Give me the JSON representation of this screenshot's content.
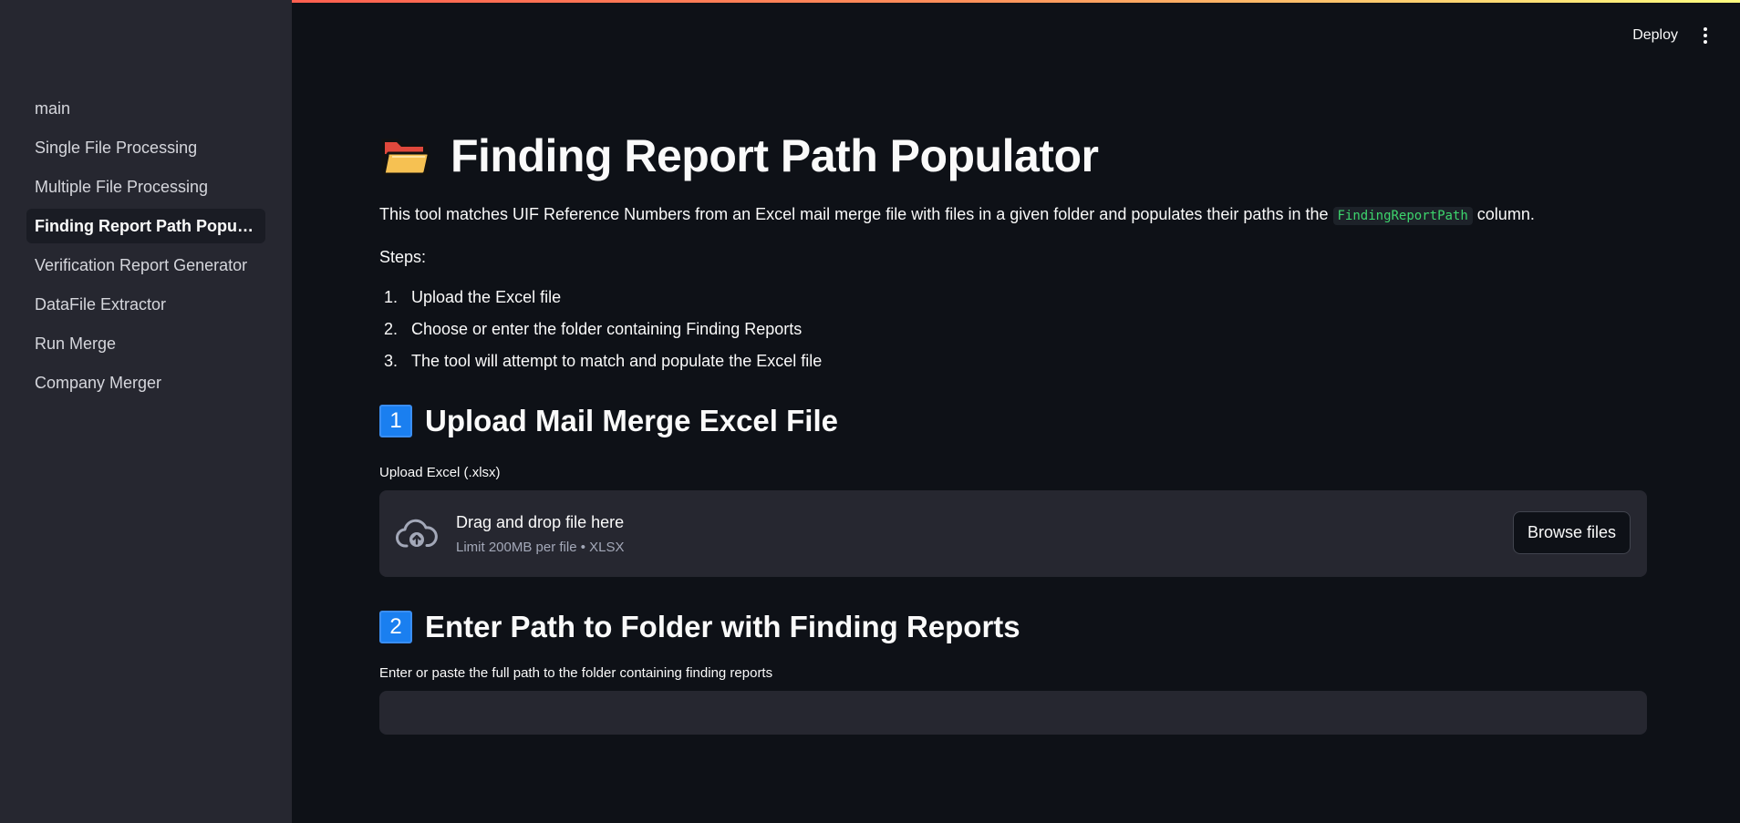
{
  "sidebar": {
    "items": [
      {
        "label": "main",
        "active": false
      },
      {
        "label": "Single File Processing",
        "active": false
      },
      {
        "label": "Multiple File Processing",
        "active": false
      },
      {
        "label": "Finding Report Path Populator",
        "active": true
      },
      {
        "label": "Verification Report Generator",
        "active": false
      },
      {
        "label": "DataFile Extractor",
        "active": false
      },
      {
        "label": "Run Merge",
        "active": false
      },
      {
        "label": "Company Merger",
        "active": false
      }
    ]
  },
  "header": {
    "deploy_label": "Deploy",
    "menu_icon": "kebab-menu-icon"
  },
  "main": {
    "title": "Finding Report Path Populator",
    "title_icon": "open-folder-icon",
    "intro_before": "This tool matches UIF Reference Numbers from an Excel mail merge file with files in a given folder and populates their paths in the ",
    "intro_code": "FindingReportPath",
    "intro_after": " column.",
    "steps_label": "Steps:",
    "steps": [
      {
        "num": "1.",
        "text": "Upload the Excel file"
      },
      {
        "num": "2.",
        "text": "Choose or enter the folder containing Finding Reports"
      },
      {
        "num": "3.",
        "text": "The tool will attempt to match and populate the Excel file"
      }
    ],
    "section1": {
      "badge": "1",
      "heading": "Upload Mail Merge Excel File",
      "field_label": "Upload Excel (.xlsx)",
      "dropzone_title": "Drag and drop file here",
      "dropzone_subtitle": "Limit 200MB per file • XLSX",
      "browse_label": "Browse files",
      "icon": "cloud-upload-icon"
    },
    "section2": {
      "badge": "2",
      "heading": "Enter Path to Folder with Finding Reports",
      "field_label": "Enter or paste the full path to the folder containing finding reports",
      "input_value": "",
      "input_placeholder": ""
    }
  },
  "colors": {
    "background": "#0e1117",
    "sidebar": "#262730",
    "accent_code": "#3dd56d",
    "keycap": "#1a7ff0"
  }
}
